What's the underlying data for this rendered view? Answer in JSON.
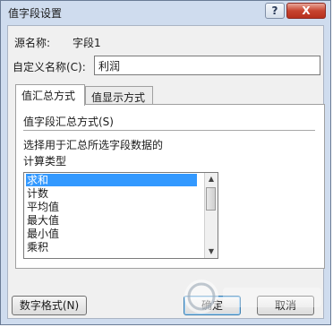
{
  "window": {
    "title": "值字段设置",
    "help_label": "?",
    "close_label": "X"
  },
  "source": {
    "label": "源名称:",
    "value": "字段1"
  },
  "custom_name": {
    "label": "自定义名称(C):",
    "value": "利润"
  },
  "tabs": [
    {
      "label": "值汇总方式",
      "active": true
    },
    {
      "label": "值显示方式",
      "active": false
    }
  ],
  "summary": {
    "section_label": "值字段汇总方式(S)",
    "description_line1": "选择用于汇总所选字段数据的",
    "description_line2": "计算类型",
    "items": [
      "求和",
      "计数",
      "平均值",
      "最大值",
      "最小值",
      "乘积"
    ],
    "selected": "求和"
  },
  "buttons": {
    "number_format": "数字格式(N)",
    "ok": "确定",
    "cancel": "取消"
  },
  "colors": {
    "title_bar": "#cfdcee",
    "selection": "#3399ff",
    "close_button": "#c7442f"
  }
}
